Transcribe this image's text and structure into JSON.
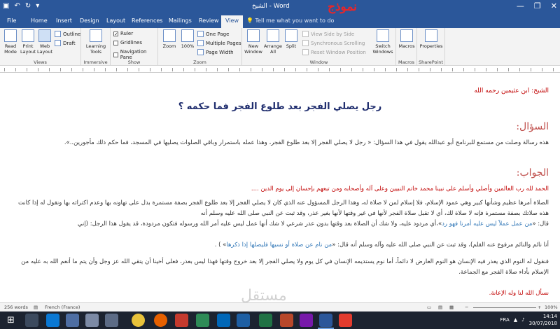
{
  "window": {
    "doc_title": "الشيخ - Word",
    "sample_label": "نموذج",
    "minimize": "—",
    "restore": "❐",
    "close": "✕"
  },
  "tabs": [
    "File",
    "Home",
    "Insert",
    "Design",
    "Layout",
    "References",
    "Mailings",
    "Review",
    "View"
  ],
  "active_tab": "View",
  "tell_me": "Tell me what you want to do",
  "ribbon": {
    "views": {
      "label": "Views",
      "read_mode": "Read Mode",
      "print_layout": "Print Layout",
      "web_layout": "Web Layout",
      "outline": "Outline",
      "draft": "Draft"
    },
    "immersive": {
      "label": "Immersive",
      "learning_tools": "Learning Tools"
    },
    "show": {
      "label": "Show",
      "ruler": "Ruler",
      "gridlines": "Gridlines",
      "navigation_pane": "Navigation Pane"
    },
    "zoom": {
      "label": "Zoom",
      "zoom": "Zoom",
      "percent": "100%",
      "one_page": "One Page",
      "multiple_pages": "Multiple Pages",
      "page_width": "Page Width"
    },
    "window": {
      "label": "Window",
      "new_window": "New Window",
      "arrange_all": "Arrange All",
      "split": "Split",
      "side_by_side": "View Side by Side",
      "sync_scroll": "Synchronous Scrolling",
      "reset_position": "Reset Window Position",
      "switch_windows": "Switch Windows"
    },
    "macros": {
      "label": "Macros",
      "macros": "Macros"
    },
    "sharepoint": {
      "label": "SharePoint",
      "properties": "Properties"
    }
  },
  "document": {
    "sheikh": "الشيخ: ابن عثيمين رحمه الله",
    "title": "رجل يصلي الفجر بعد طلوع الفجر فما حكمه ؟",
    "q_head": "السؤال:",
    "q_text": "هذه رسالة وصلت من مستمع للبرنامج أبو عبدالله يقول في هذا السؤال: « رجل لا يصلي الفجر إلا بعد طلوع الفجر، وهذا عمله باستمرار وباقي الصلوات يصليها في المسجد، فما حكم ذلك مأجورين..».",
    "a_head": "الجواب:",
    "a_praise": "الحمد لله رب العالمين وأصلي وأسلم على نبينا محمد خاتم النبيين وعلى آله وأصحابه ومن تبعهم بإحسان إلى يوم الدين ....",
    "a_text1": "الصلاة أمرها عظيم وشأنها كبير وهي عمود الإسلام، فلا إسلام لمن لا صلاة له، وهذا الرجل المسؤول عنه الذي كان لا يصلي الفجر إلا بعد طلوع الفجر بصفة مستمرة بدل على تهاونه بها وعدم اكتراثه بها ونقول له إذا كانت هذه صلاتك بصفة مستمرة فإنه لا صلاة لك، أي لا تقبل صلاة الفجر لأنها في غير وقتها لأنها بغير عذر، وقد ثبت عن النبي صلى الله عليه وسلم أنه",
    "a_text2_pre": "قال: «",
    "a_quote1": "من عمل عملاً ليس عليه أمرنا فهو رد",
    "a_text2_post": "»،أي مردود عليه، ولا شك أن الصلاة بعد وقتها بدون عذر شرعي لا شك أنها عمل ليس عليه أمر الله ورسوله فتكون مردودة، قد يقول هذا الرجل: (إني",
    "a_text3_pre": "أنا نائم والنائم مرفوع عنه القلم)، وقد ثبت عن النبي صلى الله عليه وآله وسلم أنه قال: «",
    "a_quote2": "من نام عن صلاة أو نسيها فليصلها إذا ذكرها",
    "a_text3_post": "» ) .",
    "a_text4": "فنقول له النوم الذي يعذر فيه الإنسان هو النوم العارض لا دائماً، أما نوم يستديمه الإنسان في كل يوم ولا يصلي الفجر إلا بعد خروج وقتها فهذا ليس بعذر، فعلى أخينا أن يتقي الله عز وجل وأن يتم ما أنعم الله به عليه من الإسلام بأداء صلاة الفجر مع الجماعة.",
    "closing": "نسأل الله لنا وله الإعانة."
  },
  "status": {
    "words": "256 words",
    "language": "French (France)",
    "zoom_value": "100%"
  },
  "taskbar": {
    "time": "14:14",
    "date": "30/07/2018",
    "lang": "FRA"
  },
  "watermark": "مستقل",
  "colors": {
    "word_blue": "#2b579a",
    "title_color": "#1f2d6e",
    "heading_red": "#c0504d",
    "text_red": "#c00000",
    "quote_blue": "#2e75b6"
  }
}
